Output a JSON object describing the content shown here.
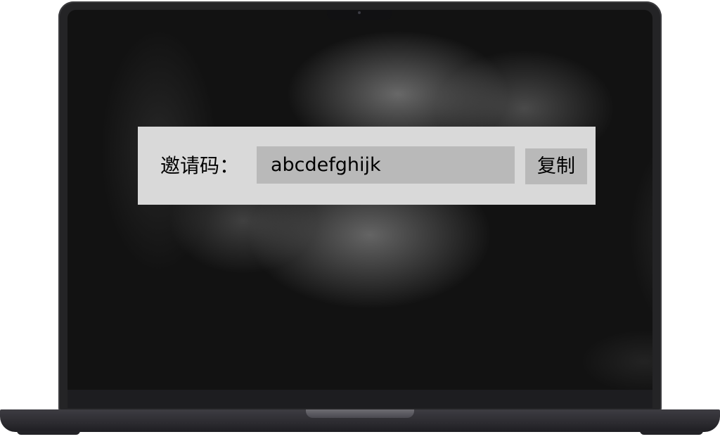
{
  "invite": {
    "label": "邀请码：",
    "code": "abcdefghijk",
    "copy_label": "复制"
  },
  "colors": {
    "panel_background": "#d9d9d9",
    "field_background": "#b9b9b9",
    "laptop_body": "#242426",
    "screen_background": "#121212"
  }
}
